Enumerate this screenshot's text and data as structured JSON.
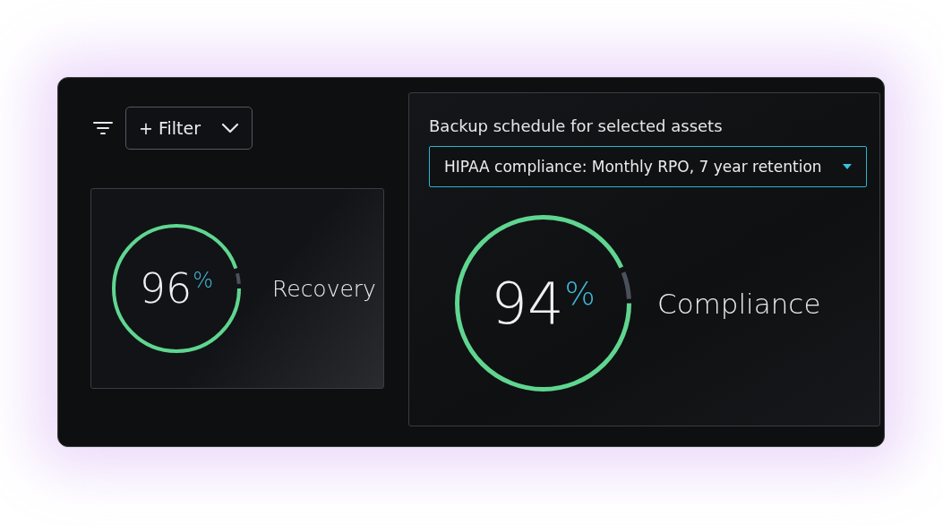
{
  "filter_button": {
    "label": "+ Filter"
  },
  "recovery": {
    "value": "96",
    "unit": "%",
    "label": "Recovery",
    "level": 0.96
  },
  "backup_schedule": {
    "label": "Backup schedule for selected assets",
    "value": "HIPAA compliance: Monthly RPO, 7 year retention"
  },
  "compliance": {
    "value": "94",
    "unit": "%",
    "label": "Compliance",
    "level": 0.94
  }
}
